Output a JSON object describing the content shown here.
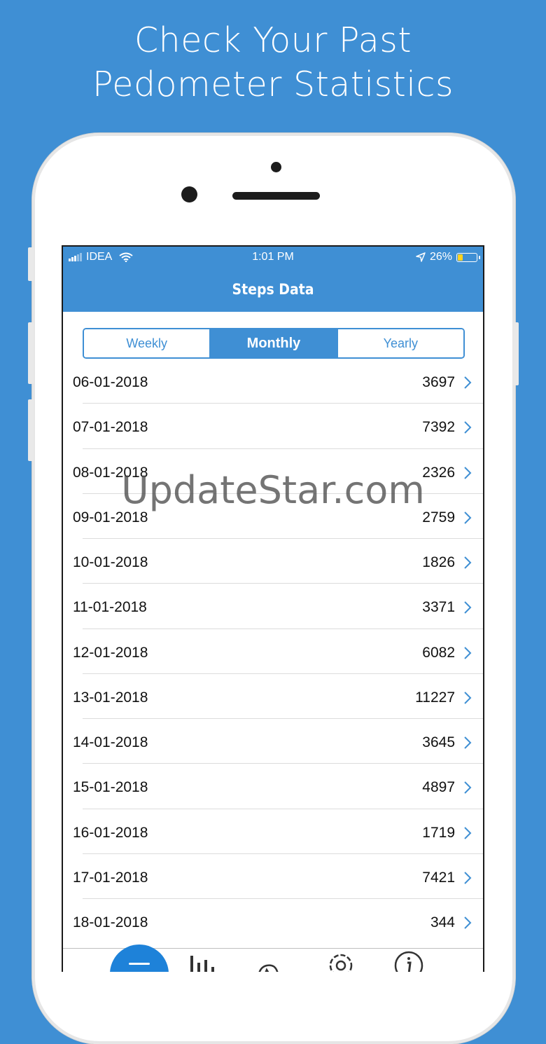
{
  "headline": {
    "line1": "Check Your Past",
    "line2": "Pedometer Statistics"
  },
  "status_bar": {
    "carrier": "IDEA",
    "time": "1:01 PM",
    "battery_percent": "26%",
    "battery_level": 0.26
  },
  "nav": {
    "title": "Steps Data"
  },
  "segments": [
    {
      "label": "Weekly",
      "active": false
    },
    {
      "label": "Monthly",
      "active": true
    },
    {
      "label": "Yearly",
      "active": false
    }
  ],
  "rows": [
    {
      "date": "06-01-2018",
      "steps": "3697"
    },
    {
      "date": "07-01-2018",
      "steps": "7392"
    },
    {
      "date": "08-01-2018",
      "steps": "2326"
    },
    {
      "date": "09-01-2018",
      "steps": "2759"
    },
    {
      "date": "10-01-2018",
      "steps": "1826"
    },
    {
      "date": "11-01-2018",
      "steps": "3371"
    },
    {
      "date": "12-01-2018",
      "steps": "6082"
    },
    {
      "date": "13-01-2018",
      "steps": "11227"
    },
    {
      "date": "14-01-2018",
      "steps": "3645"
    },
    {
      "date": "15-01-2018",
      "steps": "4897"
    },
    {
      "date": "16-01-2018",
      "steps": "1719"
    },
    {
      "date": "17-01-2018",
      "steps": "7421"
    },
    {
      "date": "18-01-2018",
      "steps": "344"
    }
  ],
  "tab_bar": {
    "items": [
      "home-icon",
      "bar-chart-icon",
      "tools-icon",
      "settings-icon",
      "info-icon"
    ]
  },
  "watermark": "UpdateStar.com",
  "colors": {
    "accent": "#3f8fd4",
    "home_button": "#1e82d9",
    "chevron": "#3f8fd4"
  }
}
